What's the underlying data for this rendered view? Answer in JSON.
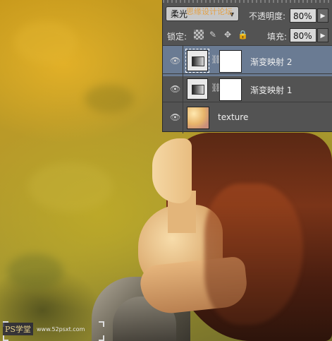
{
  "watermark_text": "思缘设计论坛",
  "layers_panel": {
    "blend_mode": "柔光",
    "opacity_label": "不透明度:",
    "opacity_value": "80%",
    "lock_label": "锁定:",
    "fill_label": "填充:",
    "fill_value": "80%",
    "layers": [
      {
        "name": "渐变映射 2",
        "type": "gradient-map",
        "selected": true,
        "visible": true
      },
      {
        "name": "渐变映射 1",
        "type": "gradient-map",
        "selected": false,
        "visible": true
      },
      {
        "name": "texture",
        "type": "image",
        "selected": false,
        "visible": true
      }
    ]
  },
  "site_logo": {
    "text": "PS学堂",
    "url": "www.52psxt.com"
  },
  "colors": {
    "panel_bg": "#535353",
    "selected_row": "#6a7b93",
    "artwork_gold": "#c99a1c"
  }
}
